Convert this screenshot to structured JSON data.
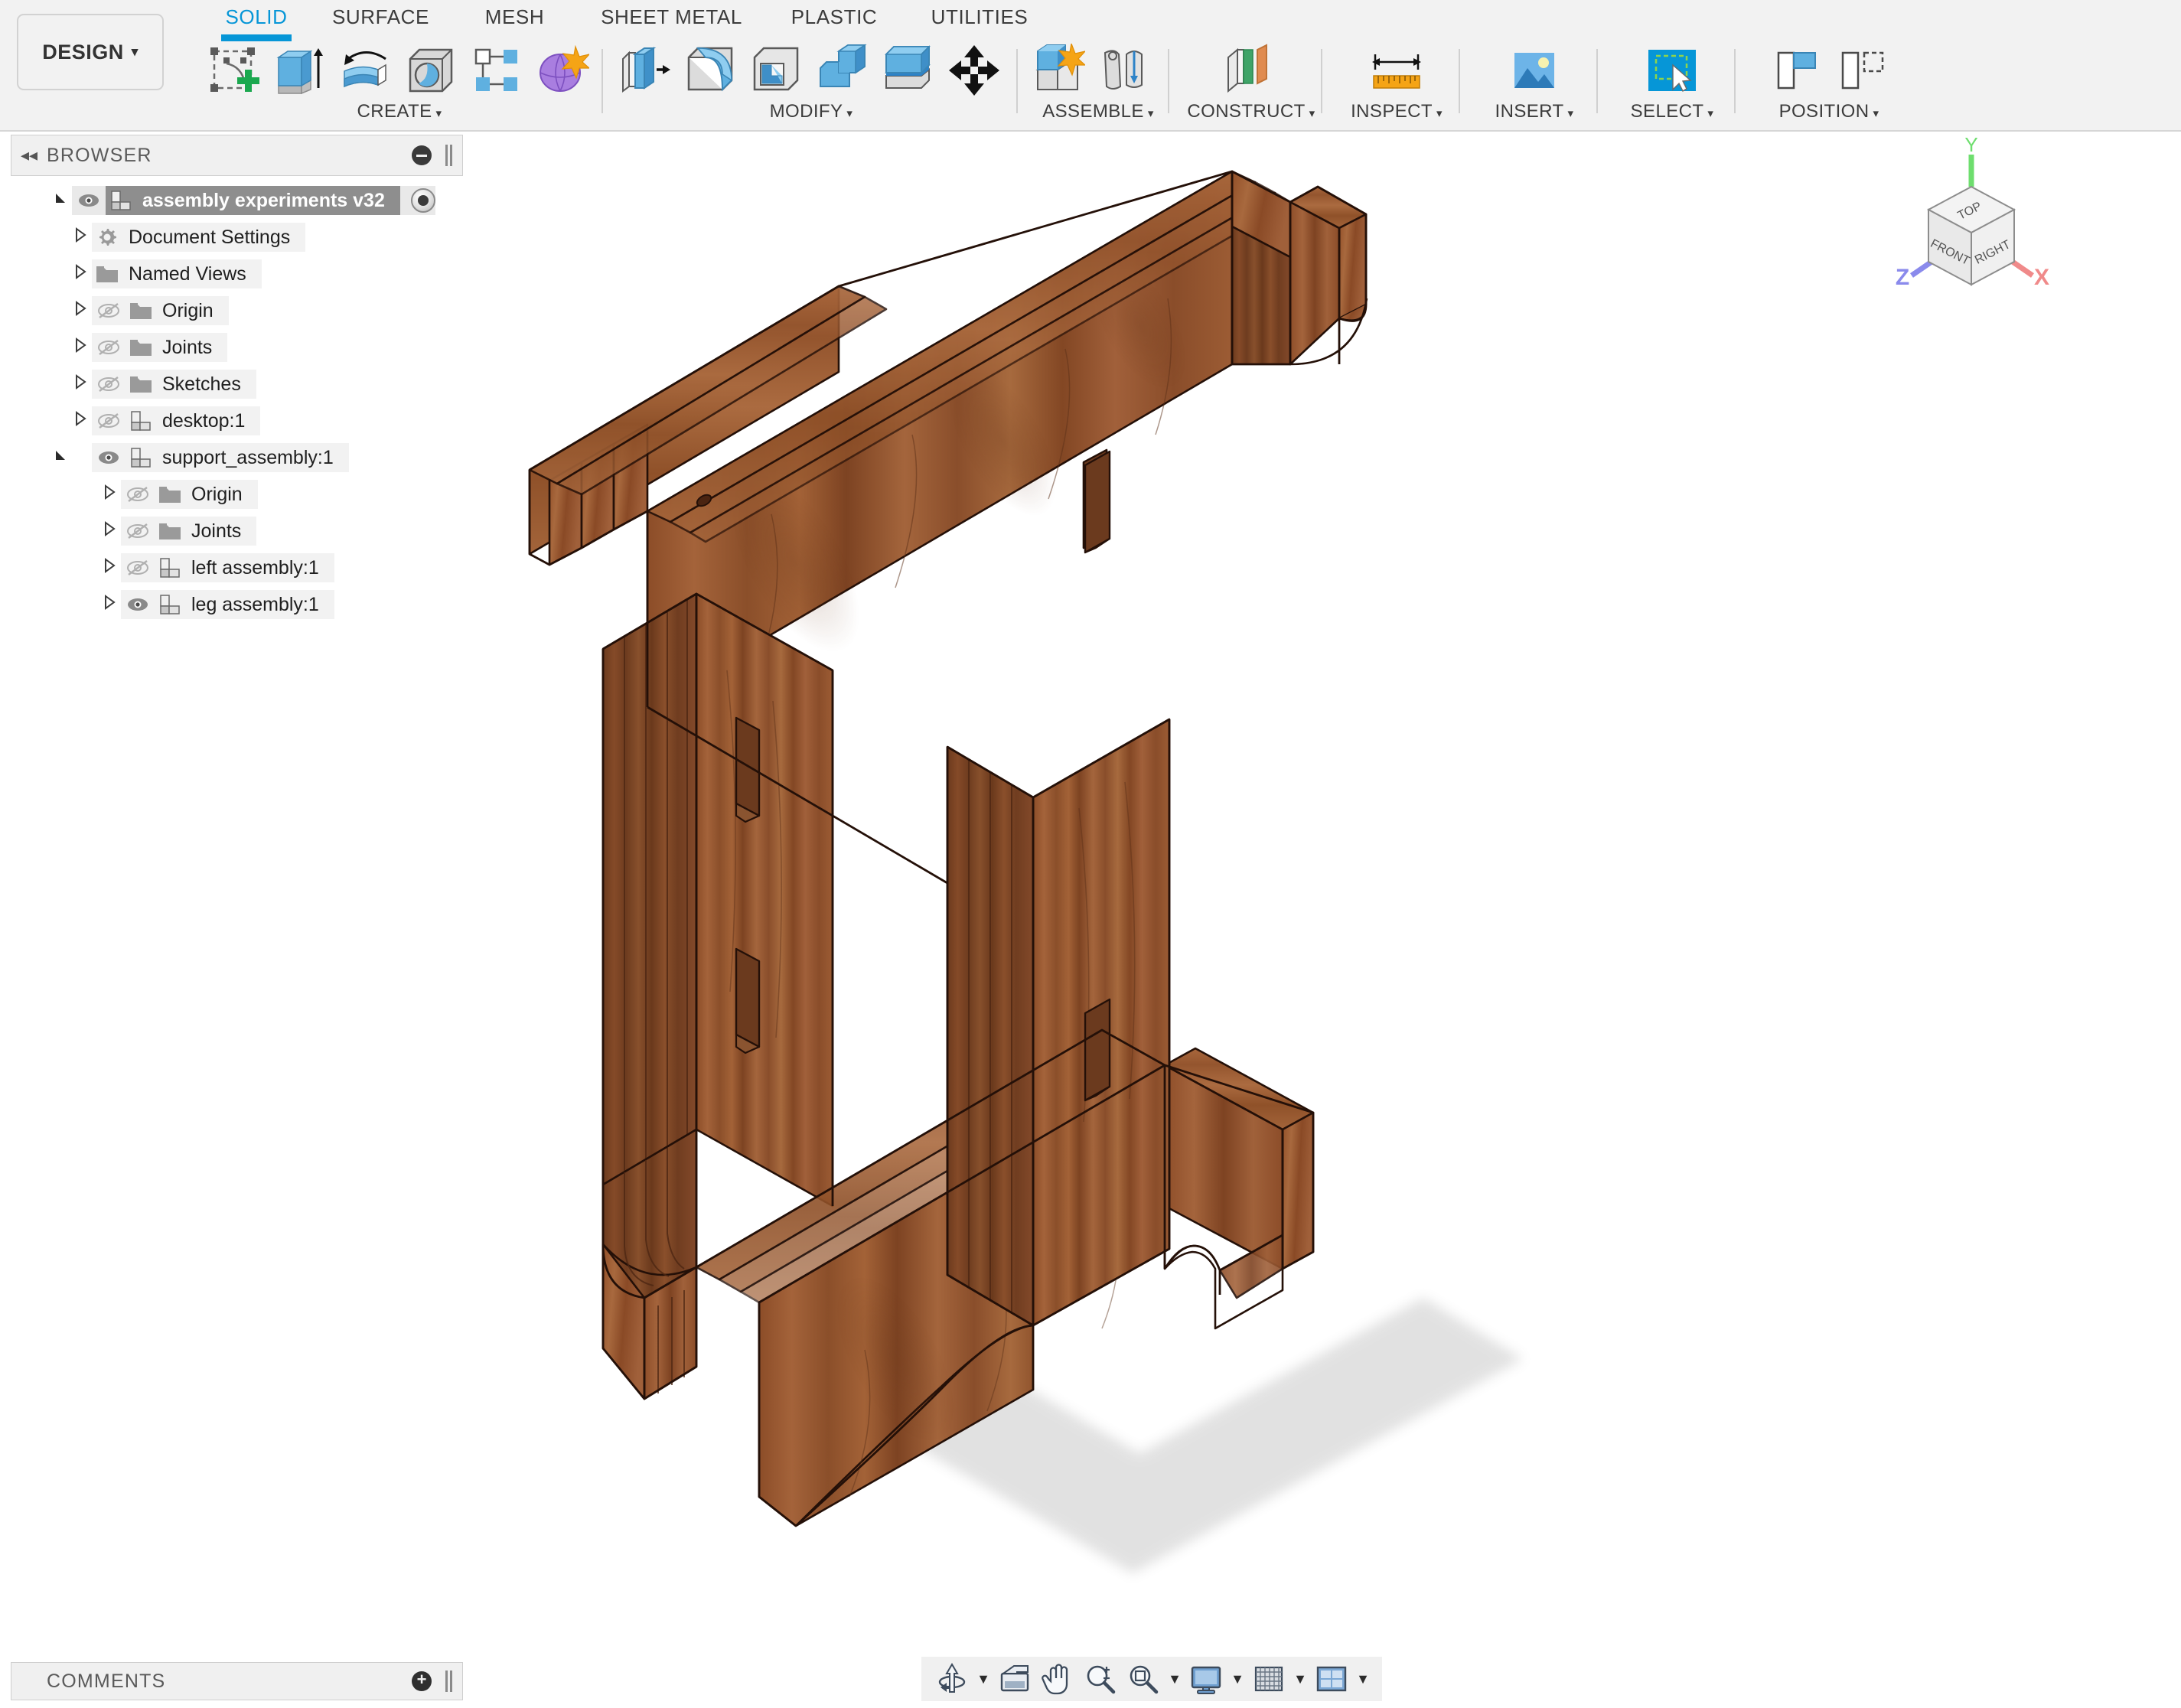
{
  "app": {
    "workspace_button": "DESIGN",
    "caret": "▾"
  },
  "tabs": [
    {
      "label": "SOLID",
      "active": true
    },
    {
      "label": "SURFACE",
      "active": false
    },
    {
      "label": "MESH",
      "active": false
    },
    {
      "label": "SHEET METAL",
      "active": false
    },
    {
      "label": "PLASTIC",
      "active": false
    },
    {
      "label": "UTILITIES",
      "active": false
    }
  ],
  "ribbon": {
    "groups": [
      {
        "label": "CREATE",
        "has_caret": true,
        "icons": [
          "create-sketch-icon",
          "extrude-icon",
          "revolve-icon",
          "sweep-icon",
          "pattern-icon",
          "form-icon"
        ]
      },
      {
        "label": "MODIFY",
        "has_caret": true,
        "icons": [
          "press-pull-icon",
          "fillet-icon",
          "shell-icon",
          "combine-icon",
          "split-face-icon",
          "move-copy-icon"
        ]
      },
      {
        "label": "ASSEMBLE",
        "has_caret": true,
        "icons": [
          "new-component-icon",
          "joint-icon"
        ]
      },
      {
        "label": "CONSTRUCT",
        "has_caret": true,
        "icons": [
          "offset-plane-icon"
        ]
      },
      {
        "label": "INSPECT",
        "has_caret": true,
        "icons": [
          "measure-icon"
        ]
      },
      {
        "label": "INSERT",
        "has_caret": true,
        "icons": [
          "insert-canvas-icon"
        ]
      },
      {
        "label": "SELECT",
        "has_caret": true,
        "icons": [
          "select-window-icon"
        ]
      },
      {
        "label": "POSITION",
        "has_caret": true,
        "icons": [
          "align-icon",
          "position-icon"
        ]
      }
    ],
    "accent_color": "#0696d7"
  },
  "browser": {
    "title": "BROWSER",
    "collapse_icon": "◂◂",
    "minimize_icon": "minimize-icon",
    "tree": [
      {
        "label": "assembly experiments v32",
        "depth": 0,
        "arrow": "expanded",
        "eye": "visible",
        "icon": "component-icon",
        "selected": true,
        "radio": true
      },
      {
        "label": "Document Settings",
        "depth": 1,
        "arrow": "collapsed",
        "eye": "none",
        "icon": "gear-icon",
        "selected": false,
        "radio": false
      },
      {
        "label": "Named Views",
        "depth": 1,
        "arrow": "collapsed",
        "eye": "none",
        "icon": "folder-icon",
        "selected": false,
        "radio": false
      },
      {
        "label": "Origin",
        "depth": 1,
        "arrow": "collapsed",
        "eye": "hidden",
        "icon": "folder-icon",
        "selected": false,
        "radio": false
      },
      {
        "label": "Joints",
        "depth": 1,
        "arrow": "collapsed",
        "eye": "hidden",
        "icon": "folder-icon",
        "selected": false,
        "radio": false
      },
      {
        "label": "Sketches",
        "depth": 1,
        "arrow": "collapsed",
        "eye": "hidden",
        "icon": "folder-icon",
        "selected": false,
        "radio": false
      },
      {
        "label": "desktop:1",
        "depth": 1,
        "arrow": "collapsed",
        "eye": "hidden",
        "icon": "component-icon",
        "selected": false,
        "radio": false
      },
      {
        "label": "support_assembly:1",
        "depth": 1,
        "arrow": "expanded",
        "eye": "visible",
        "icon": "component-icon",
        "selected": false,
        "radio": false
      },
      {
        "label": "Origin",
        "depth": 2,
        "arrow": "collapsed",
        "eye": "hidden",
        "icon": "folder-icon",
        "selected": false,
        "radio": false
      },
      {
        "label": "Joints",
        "depth": 2,
        "arrow": "collapsed",
        "eye": "hidden",
        "icon": "folder-icon",
        "selected": false,
        "radio": false
      },
      {
        "label": "left assembly:1",
        "depth": 2,
        "arrow": "collapsed",
        "eye": "hidden",
        "icon": "component-icon",
        "selected": false,
        "radio": false
      },
      {
        "label": "leg assembly:1",
        "depth": 2,
        "arrow": "collapsed",
        "eye": "visible",
        "icon": "component-icon",
        "selected": false,
        "radio": false
      }
    ]
  },
  "viewcube": {
    "top_face": "TOP",
    "front_face": "FRONT",
    "right_face": "RIGHT",
    "axis_x": "X",
    "axis_y": "Y",
    "axis_z": "Z",
    "axis_x_color": "#f08a8a",
    "axis_y_color": "#6ede6e",
    "axis_z_color": "#8a8aec"
  },
  "model": {
    "description": "wooden trestle frame assembly",
    "wood_color_light": "#a9673c",
    "wood_color_mid": "#8d4f2b",
    "wood_color_dark": "#6d3a1e",
    "wood_color_darkest": "#5a2f18",
    "edge_color": "#241008"
  },
  "comments": {
    "title": "COMMENTS",
    "add_icon": "add-icon"
  },
  "navbar": {
    "items": [
      {
        "icon": "orbit-icon",
        "caret": true
      },
      {
        "icon": "look-at-icon",
        "caret": false
      },
      {
        "icon": "pan-icon",
        "caret": false
      },
      {
        "icon": "zoom-icon",
        "caret": false
      },
      {
        "icon": "fit-icon",
        "caret": true
      },
      {
        "icon": "display-settings-icon",
        "caret": true
      },
      {
        "icon": "grid-snap-icon",
        "caret": true
      },
      {
        "icon": "viewports-icon",
        "caret": true
      }
    ]
  }
}
